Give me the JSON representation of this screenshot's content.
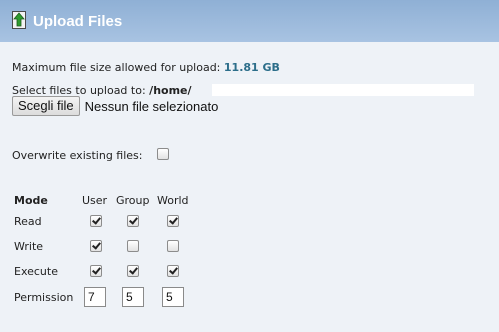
{
  "header": {
    "title": "Upload Files",
    "icon": "upload-arrow-icon"
  },
  "upload": {
    "max_size_label": "Maximum file size allowed for upload:",
    "max_size_value": "11.81 GB",
    "select_label": "Select files to upload to:",
    "target_path": "/home/",
    "choose_button": "Scegli file",
    "no_file_text": "Nessun file selezionato"
  },
  "overwrite": {
    "label": "Overwrite existing files:",
    "checked": false
  },
  "permissions": {
    "headers": {
      "mode": "Mode",
      "user": "User",
      "group": "Group",
      "world": "World"
    },
    "rows": [
      {
        "label": "Read",
        "user": true,
        "group": true,
        "world": true
      },
      {
        "label": "Write",
        "user": true,
        "group": false,
        "world": false
      },
      {
        "label": "Execute",
        "user": true,
        "group": true,
        "world": true
      }
    ],
    "permission_label": "Permission",
    "values": {
      "user": "7",
      "group": "5",
      "world": "5"
    }
  },
  "colors": {
    "header_bg": "#9bb8dc",
    "accent_value": "#2c6e8a",
    "page_bg": "#eef2f7"
  }
}
